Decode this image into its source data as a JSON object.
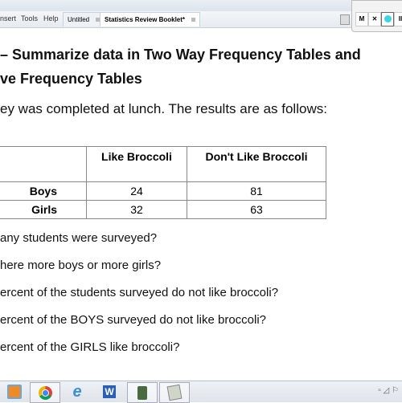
{
  "menu": [
    "nsert",
    "Tools",
    "Help"
  ],
  "tabs": [
    {
      "label": "Untitled"
    },
    {
      "label": "Statistics Review Booklet*"
    }
  ],
  "recorder": {
    "buttons": [
      "M",
      "✕",
      "",
      ""
    ]
  },
  "doc": {
    "title_line1": "– Summarize data in Two Way Frequency Tables and",
    "title_line2": "ve Frequency Tables",
    "intro": "ey was completed at lunch.  The results are as follows:",
    "table": {
      "headers": [
        "",
        "Like Broccoli",
        "Don't Like Broccoli"
      ],
      "rows": [
        {
          "label": "Boys",
          "like": "24",
          "dislike": "81"
        },
        {
          "label": "Girls",
          "like": "32",
          "dislike": "63"
        }
      ]
    },
    "questions": [
      "any students were surveyed?",
      "here more boys or more girls?",
      "ercent of the students surveyed do not like broccoli?",
      "ercent of the BOYS surveyed do not like broccoli?",
      "ercent of the GIRLS like broccoli?"
    ]
  },
  "taskbar": {
    "apps": [
      "media-player-icon",
      "chrome-icon",
      "internet-explorer-icon",
      "word-icon",
      "calculator-icon",
      "notes-app-icon"
    ]
  }
}
